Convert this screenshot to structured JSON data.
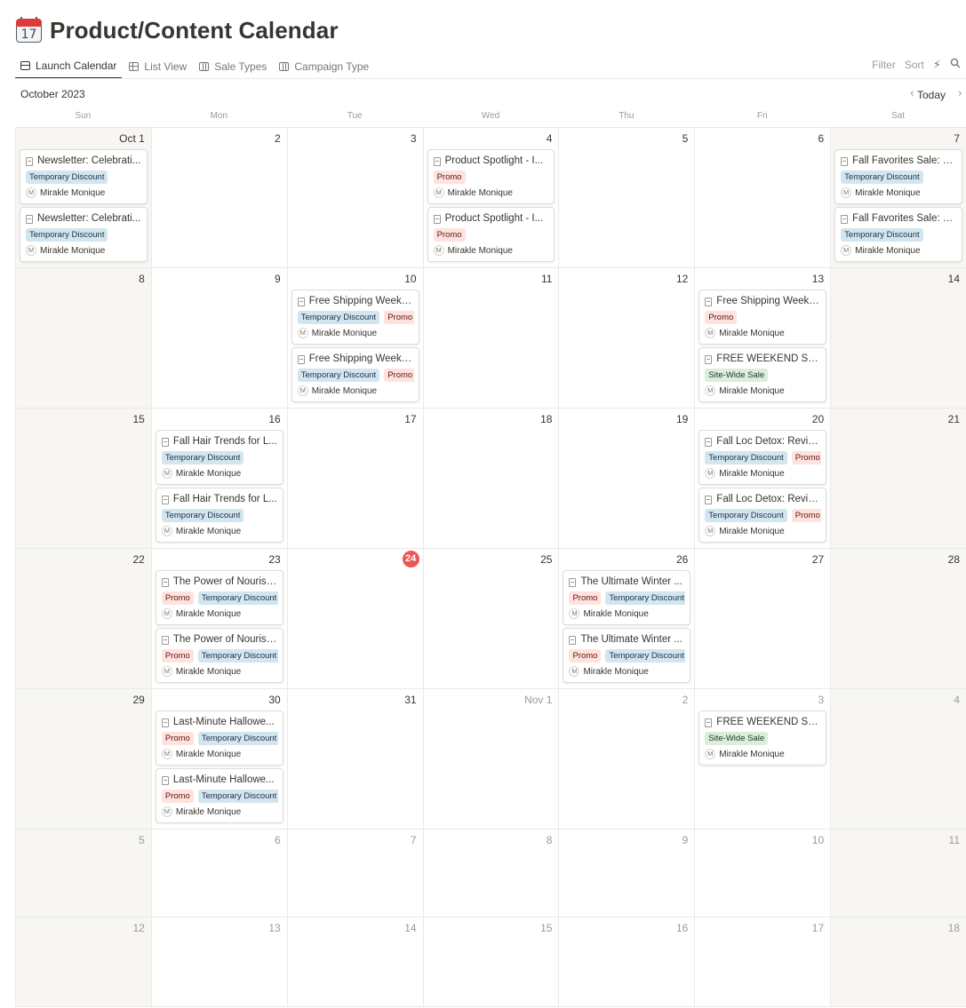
{
  "page": {
    "icon_num": "17",
    "title": "Product/Content Calendar"
  },
  "views": [
    {
      "label": "Launch Calendar",
      "icon": "calendar-icon",
      "active": true
    },
    {
      "label": "List View",
      "icon": "table-icon",
      "active": false
    },
    {
      "label": "Sale Types",
      "icon": "board-icon",
      "active": false
    },
    {
      "label": "Campaign Type",
      "icon": "board-icon",
      "active": false
    }
  ],
  "toolbar": {
    "filter": "Filter",
    "sort": "Sort",
    "automation_icon": "⚡",
    "search_icon": "⚲"
  },
  "month": {
    "label": "October 2023",
    "prev": "‹",
    "today": "Today",
    "next": "›"
  },
  "weekdays": [
    "Sun",
    "Mon",
    "Tue",
    "Wed",
    "Thu",
    "Fri",
    "Sat"
  ],
  "colors": {
    "today_marker": "#eb5757",
    "tag_blue": "#d3e5ef",
    "tag_red": "#ffe2dd",
    "tag_green": "#dbeddb",
    "weekend_bg": "#f7f6f3"
  },
  "weeks": [
    [
      {
        "num": "Oct 1",
        "events": [
          {
            "title": "Newsletter: Celebrati...",
            "tags": [
              {
                "label": "Temporary Discount",
                "color": "blue"
              }
            ],
            "avatar": "M",
            "person": "Mirakle Monique"
          },
          {
            "title": "Newsletter: Celebrati...",
            "tags": [
              {
                "label": "Temporary Discount",
                "color": "blue"
              }
            ],
            "avatar": "M",
            "person": "Mirakle Monique"
          }
        ]
      },
      {
        "num": "2",
        "events": []
      },
      {
        "num": "3",
        "events": []
      },
      {
        "num": "4",
        "events": [
          {
            "title": "Product Spotlight - I...",
            "tags": [
              {
                "label": "Promo",
                "color": "red"
              }
            ],
            "avatar": "M",
            "person": "Mirakle Monique"
          },
          {
            "title": "Product Spotlight - I...",
            "tags": [
              {
                "label": "Promo",
                "color": "red"
              }
            ],
            "avatar": "M",
            "person": "Mirakle Monique"
          }
        ]
      },
      {
        "num": "5",
        "events": []
      },
      {
        "num": "6",
        "events": []
      },
      {
        "num": "7",
        "events": [
          {
            "title": "Fall Favorites Sale: 25...",
            "tags": [
              {
                "label": "Temporary Discount",
                "color": "blue"
              }
            ],
            "avatar": "M",
            "person": "Mirakle Monique"
          },
          {
            "title": "Fall Favorites Sale: 25...",
            "tags": [
              {
                "label": "Temporary Discount",
                "color": "blue"
              }
            ],
            "avatar": "M",
            "person": "Mirakle Monique"
          }
        ]
      }
    ],
    [
      {
        "num": "8",
        "events": []
      },
      {
        "num": "9",
        "events": []
      },
      {
        "num": "10",
        "events": [
          {
            "title": "Free Shipping Weeke...",
            "tags": [
              {
                "label": "Temporary Discount",
                "color": "blue"
              },
              {
                "label": "Promo",
                "color": "red"
              }
            ],
            "avatar": "M",
            "person": "Mirakle Monique"
          },
          {
            "title": "Free Shipping Weeke...",
            "tags": [
              {
                "label": "Temporary Discount",
                "color": "blue"
              },
              {
                "label": "Promo",
                "color": "red"
              }
            ],
            "avatar": "M",
            "person": "Mirakle Monique"
          }
        ]
      },
      {
        "num": "11",
        "events": []
      },
      {
        "num": "12",
        "events": []
      },
      {
        "num": "13",
        "events": [
          {
            "title": "Free Shipping Weeke...",
            "tags": [
              {
                "label": "Promo",
                "color": "red"
              }
            ],
            "avatar": "M",
            "person": "Mirakle Monique"
          },
          {
            "title": "FREE WEEKEND SHIP...",
            "tags": [
              {
                "label": "Site-Wide Sale",
                "color": "green"
              }
            ],
            "avatar": "M",
            "person": "Mirakle Monique"
          }
        ]
      },
      {
        "num": "14",
        "events": []
      }
    ],
    [
      {
        "num": "15",
        "events": []
      },
      {
        "num": "16",
        "events": [
          {
            "title": "Fall Hair Trends for L...",
            "tags": [
              {
                "label": "Temporary Discount",
                "color": "blue"
              }
            ],
            "avatar": "M",
            "person": "Mirakle Monique"
          },
          {
            "title": "Fall Hair Trends for L...",
            "tags": [
              {
                "label": "Temporary Discount",
                "color": "blue"
              }
            ],
            "avatar": "M",
            "person": "Mirakle Monique"
          }
        ]
      },
      {
        "num": "17",
        "events": []
      },
      {
        "num": "18",
        "events": []
      },
      {
        "num": "19",
        "events": []
      },
      {
        "num": "20",
        "events": [
          {
            "title": "Fall Loc Detox: Revive...",
            "tags": [
              {
                "label": "Temporary Discount",
                "color": "blue"
              },
              {
                "label": "Promo",
                "color": "red"
              }
            ],
            "avatar": "M",
            "person": "Mirakle Monique"
          },
          {
            "title": "Fall Loc Detox: Revive...",
            "tags": [
              {
                "label": "Temporary Discount",
                "color": "blue"
              },
              {
                "label": "Promo",
                "color": "red"
              }
            ],
            "avatar": "M",
            "person": "Mirakle Monique"
          }
        ]
      },
      {
        "num": "21",
        "events": []
      }
    ],
    [
      {
        "num": "22",
        "events": []
      },
      {
        "num": "23",
        "events": [
          {
            "title": "The Power of Nourish...",
            "tags": [
              {
                "label": "Promo",
                "color": "red"
              },
              {
                "label": "Temporary Discount",
                "color": "blue"
              }
            ],
            "avatar": "M",
            "person": "Mirakle Monique"
          },
          {
            "title": "The Power of Nourish...",
            "tags": [
              {
                "label": "Promo",
                "color": "red"
              },
              {
                "label": "Temporary Discount",
                "color": "blue"
              }
            ],
            "avatar": "M",
            "person": "Mirakle Monique"
          }
        ]
      },
      {
        "num": "24",
        "today": true,
        "events": []
      },
      {
        "num": "25",
        "events": []
      },
      {
        "num": "26",
        "events": [
          {
            "title": "The Ultimate Winter ...",
            "tags": [
              {
                "label": "Promo",
                "color": "red"
              },
              {
                "label": "Temporary Discount",
                "color": "blue"
              }
            ],
            "avatar": "M",
            "person": "Mirakle Monique"
          },
          {
            "title": "The Ultimate Winter ...",
            "tags": [
              {
                "label": "Promo",
                "color": "red"
              },
              {
                "label": "Temporary Discount",
                "color": "blue"
              }
            ],
            "avatar": "M",
            "person": "Mirakle Monique"
          }
        ]
      },
      {
        "num": "27",
        "events": []
      },
      {
        "num": "28",
        "events": []
      }
    ],
    [
      {
        "num": "29",
        "events": []
      },
      {
        "num": "30",
        "events": [
          {
            "title": "Last-Minute Hallowe...",
            "tags": [
              {
                "label": "Promo",
                "color": "red"
              },
              {
                "label": "Temporary Discount",
                "color": "blue"
              }
            ],
            "avatar": "M",
            "person": "Mirakle Monique"
          },
          {
            "title": "Last-Minute Hallowe...",
            "tags": [
              {
                "label": "Promo",
                "color": "red"
              },
              {
                "label": "Temporary Discount",
                "color": "blue"
              }
            ],
            "avatar": "M",
            "person": "Mirakle Monique"
          }
        ]
      },
      {
        "num": "31",
        "events": []
      },
      {
        "num": "Nov 1",
        "other": true,
        "events": []
      },
      {
        "num": "2",
        "other": true,
        "events": []
      },
      {
        "num": "3",
        "other": true,
        "events": [
          {
            "title": "FREE WEEKEND SHIP...",
            "tags": [
              {
                "label": "Site-Wide Sale",
                "color": "green"
              }
            ],
            "avatar": "M",
            "person": "Mirakle Monique"
          }
        ]
      },
      {
        "num": "4",
        "other": true,
        "events": []
      }
    ],
    [
      {
        "num": "5",
        "other": true,
        "events": []
      },
      {
        "num": "6",
        "other": true,
        "events": []
      },
      {
        "num": "7",
        "other": true,
        "events": []
      },
      {
        "num": "8",
        "other": true,
        "events": []
      },
      {
        "num": "9",
        "other": true,
        "events": []
      },
      {
        "num": "10",
        "other": true,
        "events": []
      },
      {
        "num": "11",
        "other": true,
        "events": []
      }
    ],
    [
      {
        "num": "12",
        "other": true,
        "events": []
      },
      {
        "num": "13",
        "other": true,
        "events": []
      },
      {
        "num": "14",
        "other": true,
        "events": []
      },
      {
        "num": "15",
        "other": true,
        "events": []
      },
      {
        "num": "16",
        "other": true,
        "events": []
      },
      {
        "num": "17",
        "other": true,
        "events": []
      },
      {
        "num": "18",
        "other": true,
        "events": []
      }
    ]
  ]
}
